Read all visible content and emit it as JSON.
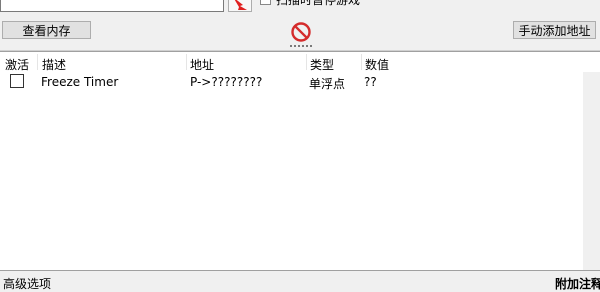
{
  "top": {
    "scan_checkbox_label": "扫描时暂停游戏"
  },
  "toolbar": {
    "view_memory": "查看内存",
    "add_address_manually": "手动添加地址"
  },
  "table": {
    "columns": [
      "激活",
      "描述",
      "地址",
      "类型",
      "数值"
    ],
    "rows": [
      {
        "active": false,
        "description": "Freeze Timer",
        "address": "P->????????",
        "type": "单浮点",
        "value": "??"
      }
    ]
  },
  "footer": {
    "advanced_options": "高级选项",
    "add_comment": "附加注释"
  },
  "colors": {
    "stop_red": "#d42b2b",
    "arrow_red": "#e02020"
  }
}
